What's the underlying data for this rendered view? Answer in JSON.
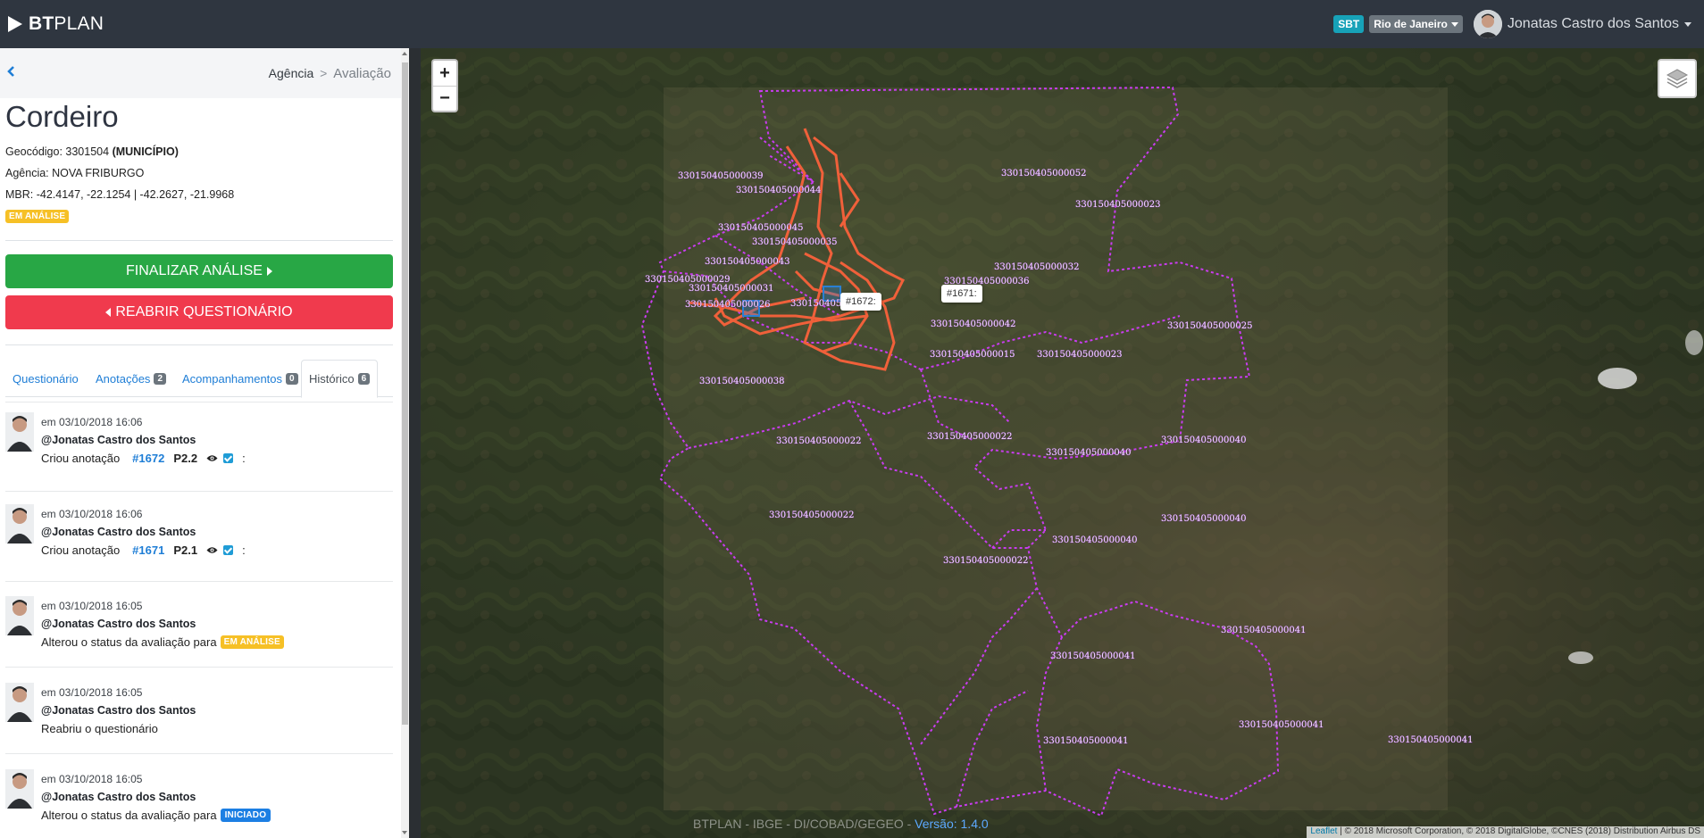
{
  "app": {
    "brand_bold": "BT",
    "brand_rest": "PLAN"
  },
  "navbar": {
    "badge_sbt": "SBT",
    "location": "Rio de Janeiro",
    "user": "Jonatas Castro dos Santos"
  },
  "sidebar": {
    "breadcrumb": {
      "parent": "Agência",
      "separator": ">",
      "current": "Avaliação"
    },
    "title": "Cordeiro",
    "geocode_label": "Geocódigo: 3301504",
    "geocode_type": "(MUNICÍPIO)",
    "agency": "Agência: NOVA FRIBURGO",
    "mbr": "MBR: -42.4147, -22.1254 | -42.2627, -21.9968",
    "status": "EM ANÁLISE",
    "finalize_btn": "FINALIZAR ANÁLISE",
    "reopen_btn": "REABRIR QUESTIONÁRIO",
    "tabs": [
      {
        "label": "Questionário",
        "count": ""
      },
      {
        "label": "Anotações",
        "count": "2"
      },
      {
        "label": "Acompanhamentos",
        "count": "0"
      },
      {
        "label": "Histórico",
        "count": "6"
      }
    ],
    "history": [
      {
        "date": "em 03/10/2018 16:06",
        "user": "@Jonatas Castro dos Santos",
        "action": "Criou anotação",
        "link": "#1672",
        "ref": "P2.2",
        "colon": ":"
      },
      {
        "date": "em 03/10/2018 16:06",
        "user": "@Jonatas Castro dos Santos",
        "action": "Criou anotação",
        "link": "#1671",
        "ref": "P2.1",
        "colon": ":"
      },
      {
        "date": "em 03/10/2018 16:05",
        "user": "@Jonatas Castro dos Santos",
        "action": "Alterou o status da avaliação para",
        "badge": "EM ANÁLISE"
      },
      {
        "date": "em 03/10/2018 16:05",
        "user": "@Jonatas Castro dos Santos",
        "action": "Reabriu o questionário"
      },
      {
        "date": "em 03/10/2018 16:05",
        "user": "@Jonatas Castro dos Santos",
        "action": "Alterou o status da avaliação para",
        "badge": "INICIADO"
      }
    ]
  },
  "map": {
    "zoom_in": "+",
    "zoom_out": "−",
    "tooltip_1": "#1672:",
    "tooltip_2": "#1671:",
    "footer_text": "BTPLAN - IBGE - DI/COBAD/GEGEO - ",
    "footer_version": "Versão: 1.4.0",
    "attribution_leaflet": "Leaflet",
    "attribution_text": "| © 2018 Microsoft Corporation, © 2018 DigitalGlobe, ©CNES (2018) Distribution Airbus DS",
    "segment_labels": [
      "330150405000039",
      "330150405000044",
      "330150405000052",
      "330150405000023",
      "330150405000045",
      "330150405000035",
      "330150405000043",
      "330150405000032",
      "330150405000029",
      "330150405000031",
      "330150405000036",
      "330150405000033",
      "330150405000026",
      "330150405000042",
      "330150405000025",
      "330150405000015",
      "330150405000023",
      "330150405000038",
      "330150405000022",
      "330150405000022",
      "330150405000040",
      "330150405000040",
      "330150405000022",
      "330150405000040",
      "330150405000040",
      "330150405000022",
      "330150405000041",
      "330150405000041",
      "330150405000041",
      "330150405000041",
      "330150405000041"
    ],
    "colors": {
      "boundary": "#c93cf0",
      "roads": "#f0603a",
      "annotation": "#2a7fd4"
    }
  }
}
